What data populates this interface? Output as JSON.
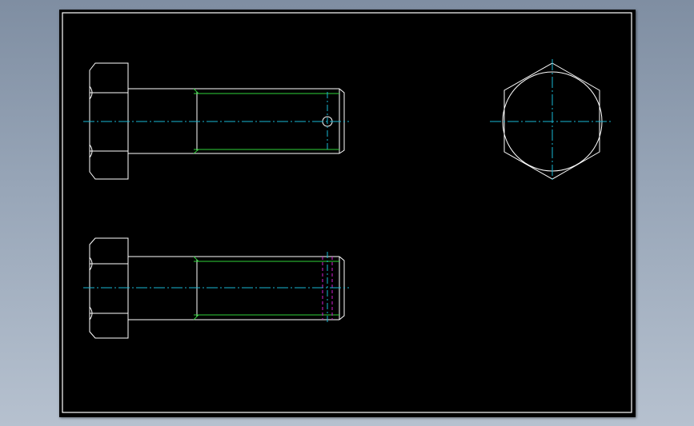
{
  "drawing": {
    "colors": {
      "outline": "#ffffff",
      "thread": "#2fd23a",
      "centerline": "#19b7d3",
      "hidden": "#d21fd2",
      "sheet_background": "#000000",
      "frame": "#ffffff"
    },
    "views": [
      {
        "name": "bolt-side-view-top",
        "kind": "hex-bolt-side",
        "features": [
          "cross-hole"
        ]
      },
      {
        "name": "bolt-side-view-bottom",
        "kind": "hex-bolt-side",
        "features": [
          "hidden-lines"
        ]
      },
      {
        "name": "bolt-end-view",
        "kind": "hex-head-end",
        "features": [
          "inscribed-circle"
        ]
      }
    ]
  }
}
